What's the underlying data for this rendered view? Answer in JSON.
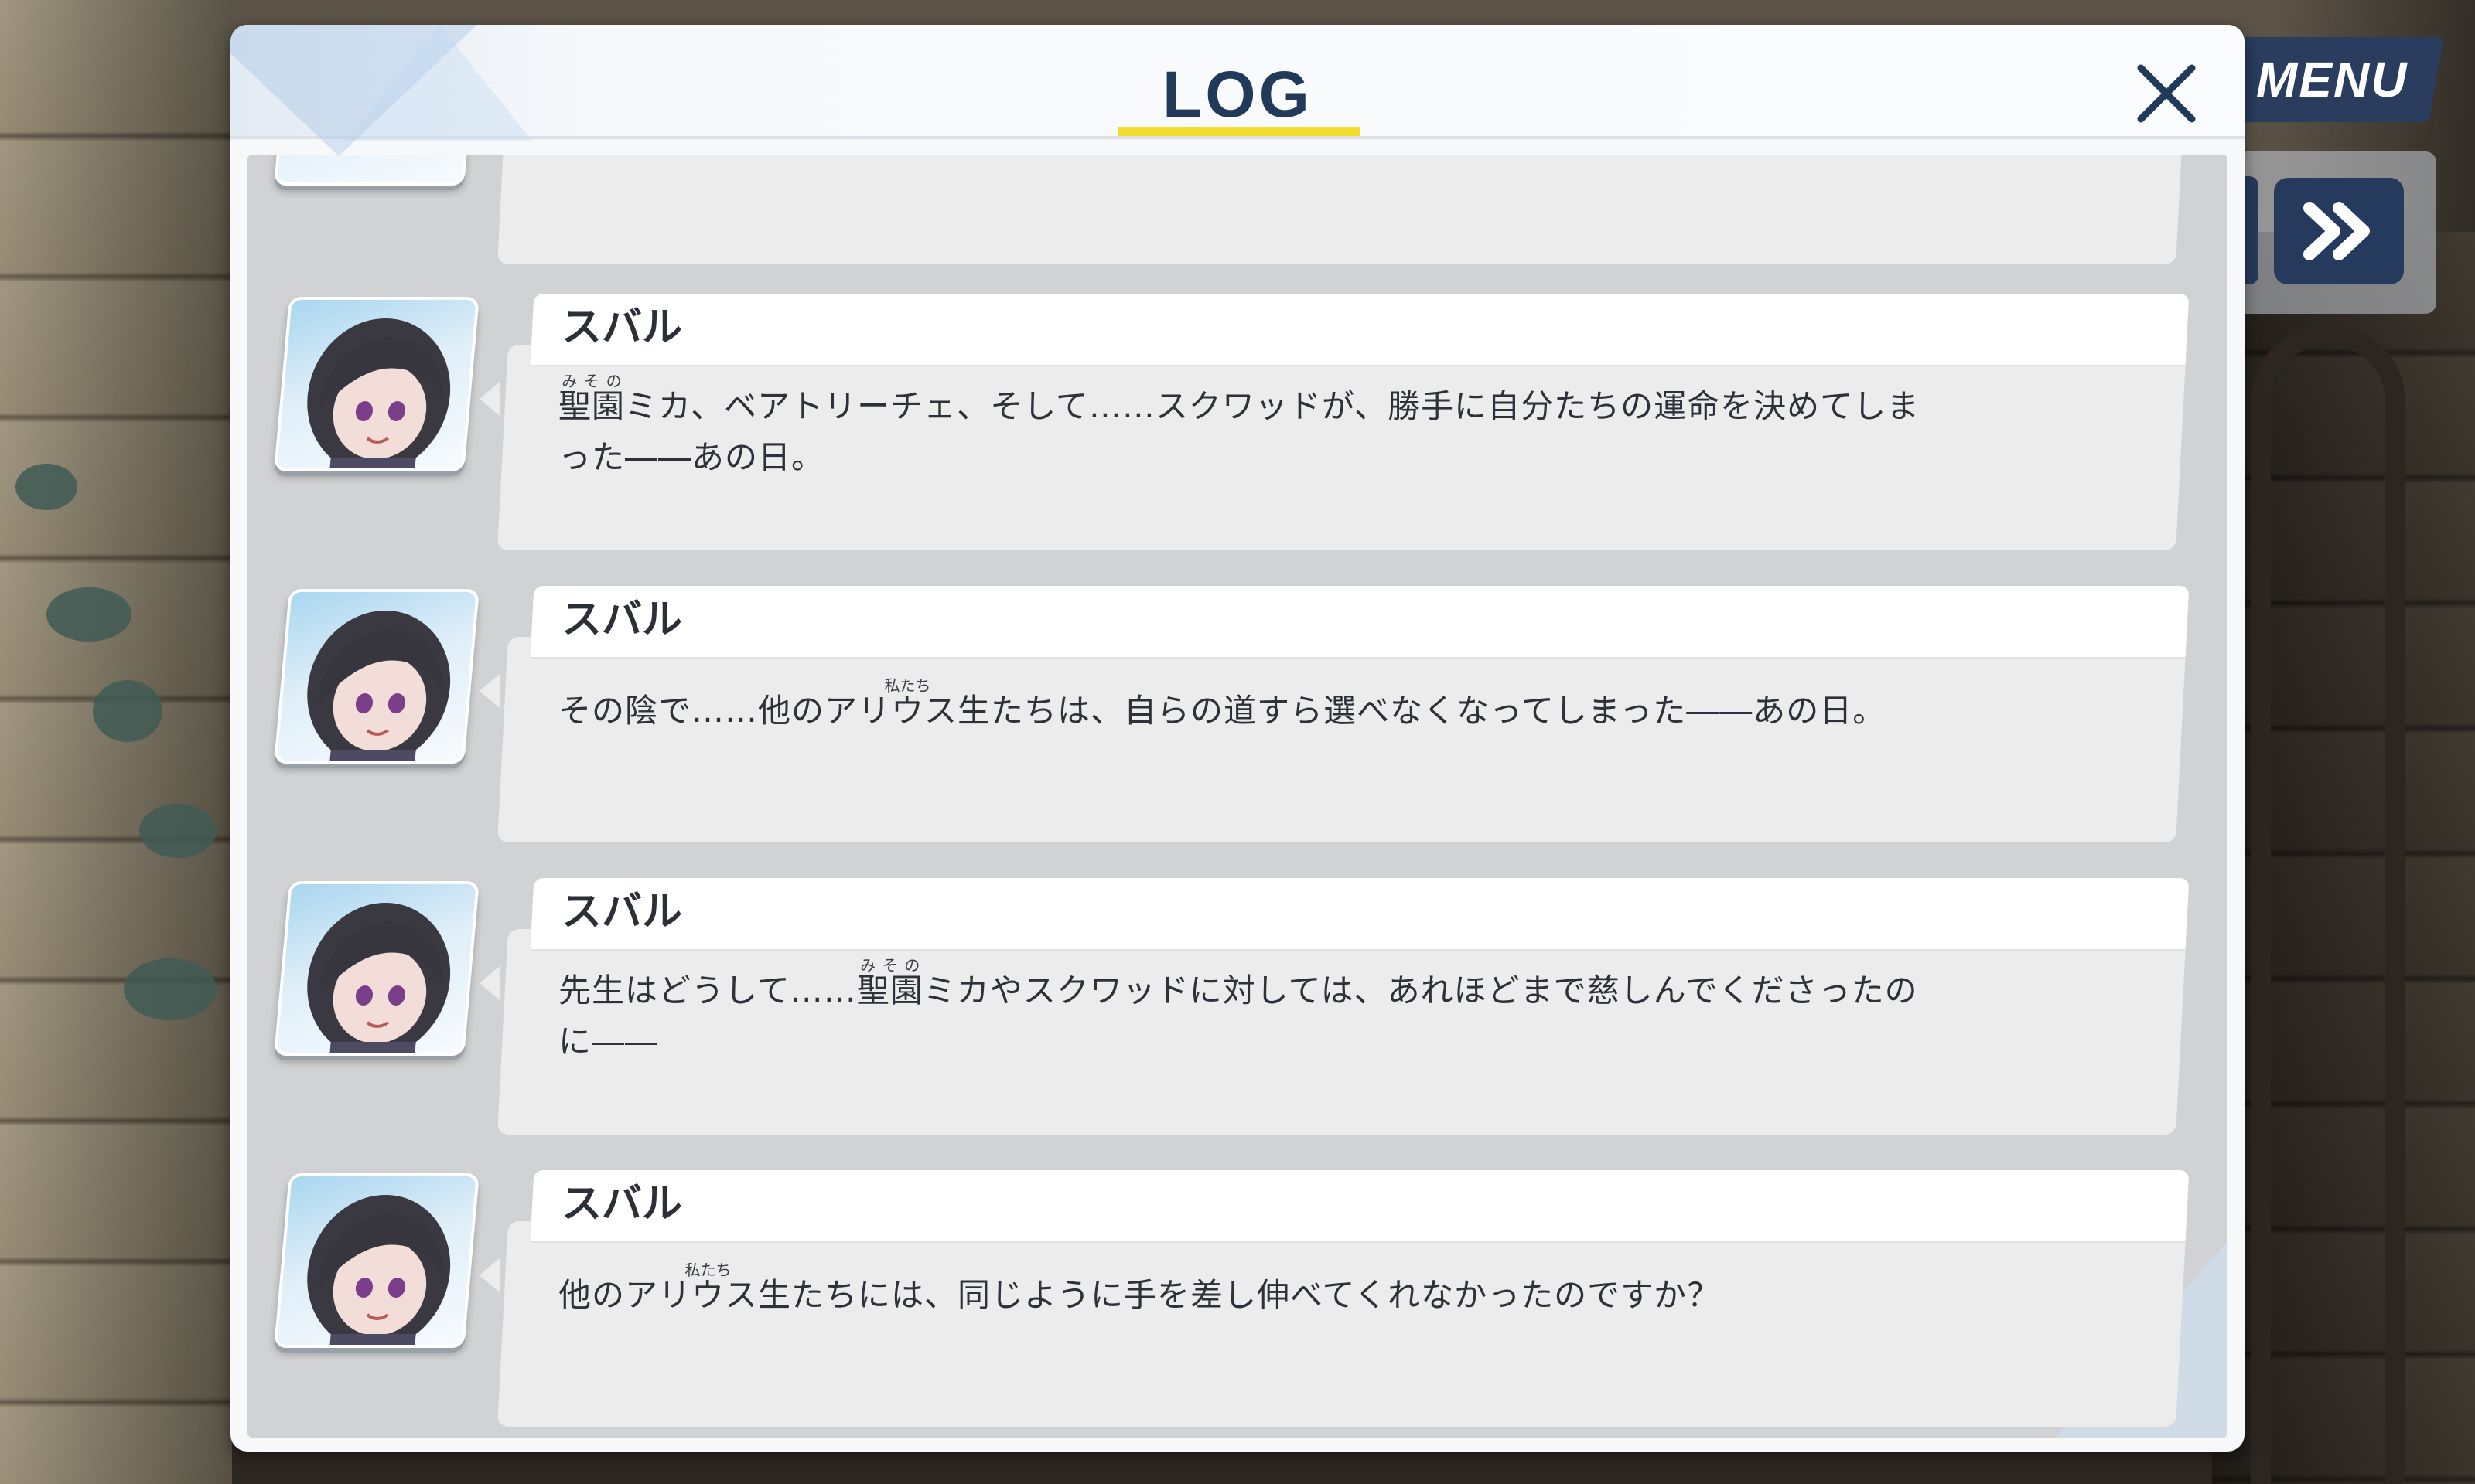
{
  "colors": {
    "title": "#213a5a",
    "title_underline": "#f2dd2c",
    "menu_button": "#2a3d5e",
    "speaker_name": "#2b2f36",
    "message_text": "#2e3138"
  },
  "hud": {
    "menu_label": "MENU",
    "skip_icon": "double-chevron-right-icon"
  },
  "log": {
    "title": "LOG",
    "close_icon": "close-x-icon",
    "entries": [
      {
        "speaker": "スバル",
        "ruby_base": "聖園",
        "ruby_text": "みその",
        "before": "",
        "after": "ミカ、ベアトリーチェ、そして……スクワッドが、勝手に自分たちの運命を決めてしまった――あの日。"
      },
      {
        "speaker": "スバル",
        "ruby_base": "私たち",
        "ruby_text": "私たち",
        "before": "その陰で……他のアリ",
        "ruby_display": "ウ",
        "after": "ス生たちは、自らの道すら選べなくなってしまった――あの日。"
      },
      {
        "speaker": "スバル",
        "ruby_base": "聖園",
        "ruby_text": "みその",
        "before": "先生はどうして……",
        "after": "ミカやスクワッドに対しては、あれほどまで慈しんでくださったのに――"
      },
      {
        "speaker": "スバル",
        "ruby_text": "私たち",
        "before": "他のアリ",
        "ruby_display": "ウ",
        "after": "ス生たちには、同じように手を差し伸べてくれなかったのですか？"
      }
    ]
  }
}
